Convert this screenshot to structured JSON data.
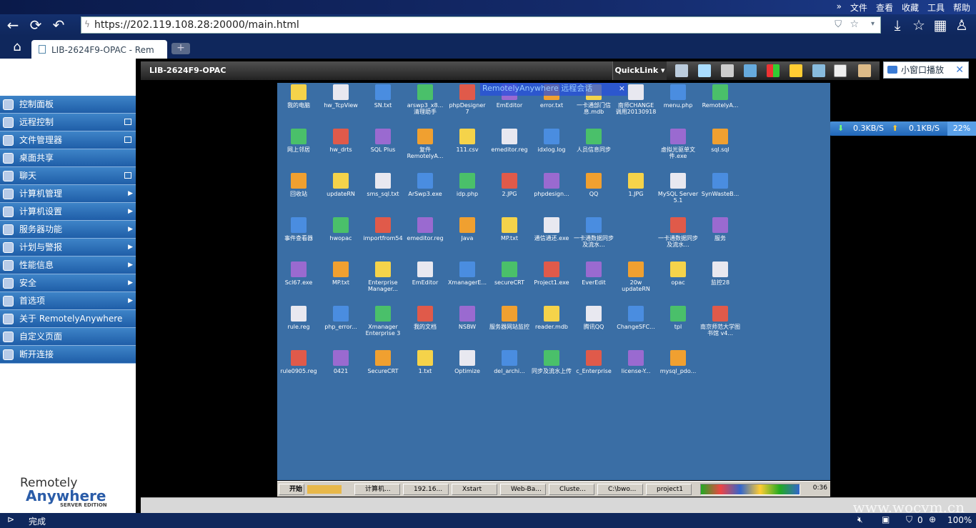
{
  "browser": {
    "menu": [
      "»",
      "文件",
      "查看",
      "收藏",
      "工具",
      "帮助"
    ],
    "url": "https://202.119.108.28:20000/main.html",
    "tab_title": "LIB-2624F9-OPAC - Rem",
    "status": "完成",
    "zoom": "100%",
    "counter": "0"
  },
  "sidebar": {
    "items": [
      {
        "label": "控制面板",
        "icon": "dashboard-icon",
        "suffix": ""
      },
      {
        "label": "远程控制",
        "icon": "remote-icon",
        "suffix": "win"
      },
      {
        "label": "文件管理器",
        "icon": "file-manager-icon",
        "suffix": "win"
      },
      {
        "label": "桌面共享",
        "icon": "share-icon",
        "suffix": ""
      },
      {
        "label": "聊天",
        "icon": "chat-icon",
        "suffix": "win"
      },
      {
        "label": "计算机管理",
        "icon": "computer-icon",
        "suffix": "arrow"
      },
      {
        "label": "计算机设置",
        "icon": "settings-icon",
        "suffix": "arrow"
      },
      {
        "label": "服务器功能",
        "icon": "server-icon",
        "suffix": "arrow"
      },
      {
        "label": "计划与警报",
        "icon": "alarm-icon",
        "suffix": "arrow"
      },
      {
        "label": "性能信息",
        "icon": "performance-icon",
        "suffix": "arrow"
      },
      {
        "label": "安全",
        "icon": "lock-icon",
        "suffix": "arrow"
      },
      {
        "label": "首选项",
        "icon": "gear-icon",
        "suffix": "arrow"
      },
      {
        "label": "关于 RemotelyAnywhere",
        "icon": "help-icon",
        "suffix": ""
      },
      {
        "label": "自定义页面",
        "icon": "page-icon",
        "suffix": ""
      },
      {
        "label": "断开连接",
        "icon": "disconnect-icon",
        "suffix": ""
      }
    ],
    "logo": {
      "line1": "Remotely",
      "line2": "Anywhere",
      "line3": "SERVER EDITION"
    }
  },
  "remote": {
    "computer_name": "LIB-2624F9-OPAC",
    "quicklink": "QuickLink ▾",
    "small_window": "小窗口播放",
    "net_down": "0.3KB/S",
    "net_up": "0.1KB/S",
    "net_pct": "22%",
    "session_banner": "RemotelyAnywhere 远程会话",
    "watermark": "www.wocvm.cn"
  },
  "desktop_icons": [
    [
      "我的电脑",
      "hw_TcpView",
      "SN.txt",
      "arswp3_x8... 清理助手",
      "phpDesigner 7",
      "EmEditor",
      "error.txt",
      "一卡通部门信息.mdb",
      "南师CHANGE调用20130918",
      "menu.php",
      "RemotelyA..."
    ],
    [
      "网上邻居",
      "hw_drts",
      "SQL Plus",
      "复件 RemotelyA...",
      "111.csv",
      "emeditor.reg",
      "idxlog.log",
      "人员信息同步",
      "",
      "虚拟光驱单文件.exe",
      "sql.sql"
    ],
    [
      "回收站",
      "updateRN",
      "sms_sql.txt",
      "ArSwp3.exe",
      "idp.php",
      "2.JPG",
      "phpdesign...",
      "QQ",
      "1.JPG",
      "MySQL Server 5.1",
      "SynWasteB..."
    ],
    [
      "事件查看器",
      "hwopac",
      "importfrom54",
      "emeditor.reg",
      "Java",
      "MP.txt",
      "通信通还.exe",
      "一卡通数据同步及流水...",
      "",
      "一卡通数据同步及流水...",
      "服务"
    ],
    [
      "Scl67.exe",
      "MP.txt",
      "Enterprise Manager...",
      "EmEditor",
      "XmanagerE...",
      "secureCRT",
      "Project1.exe",
      "EverEdit",
      "20w updateRN",
      "opac",
      "监控28"
    ],
    [
      "rule.reg",
      "php_error...",
      "Xmanager Enterprise 3",
      "我的文档",
      "NSBW",
      "服务器网站监控",
      "reader.mdb",
      "腾讯QQ",
      "ChangeSFC...",
      "tpl",
      "南京师范大学图书馆 v4..."
    ],
    [
      "rule0905.reg",
      "0421",
      "SecureCRT",
      "1.txt",
      "Optimize",
      "del_archi...",
      "同步及流水上传",
      "c_Enterprise",
      "license-Y...",
      "mysql_pdo..."
    ]
  ],
  "taskbar": {
    "start": "开始",
    "items": [
      "计算机...",
      "192.16...",
      "Xstart",
      "Web-Ba...",
      "Cluste...",
      "C:\\bwo...",
      "project1"
    ],
    "clock": "0:36"
  }
}
